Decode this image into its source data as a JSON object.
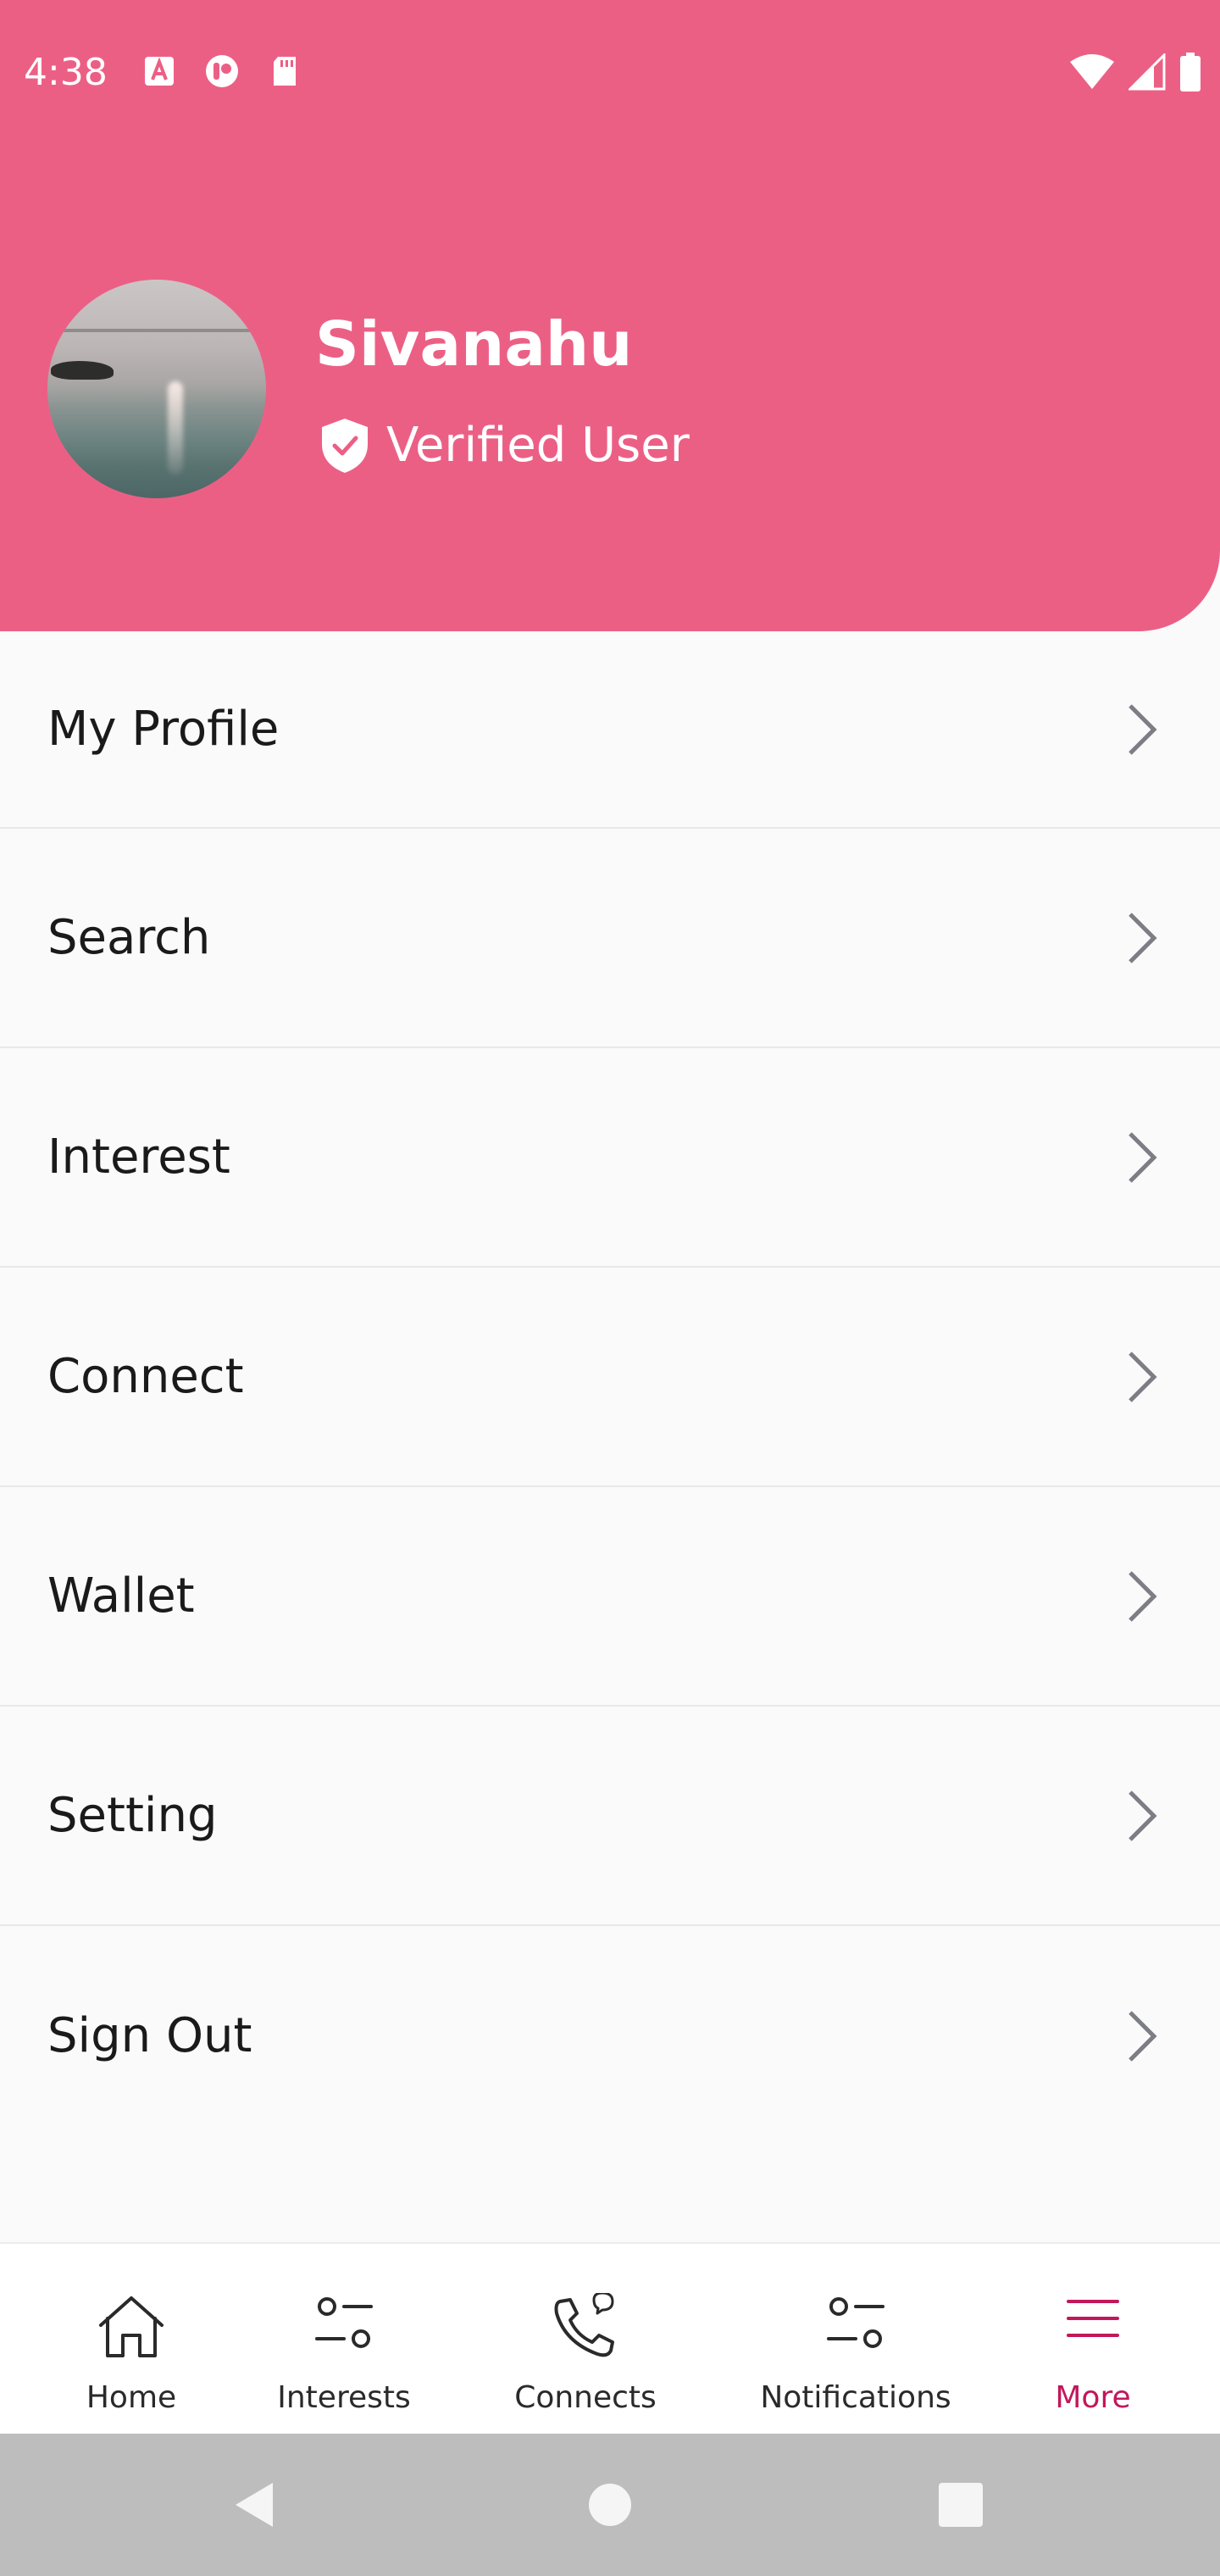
{
  "status_bar": {
    "time": "4:38",
    "left_icons": [
      "text-a-icon",
      "circle-app-icon",
      "sd-card-icon"
    ],
    "right_icons": [
      "wifi-icon",
      "cell-signal-icon",
      "battery-icon"
    ]
  },
  "profile": {
    "name": "Sivanahu",
    "badge_icon": "shield-check-icon",
    "badge_text": "Verified User",
    "header_color": "#ec5f85"
  },
  "menu": {
    "items": [
      {
        "label": "My Profile",
        "icon": "chevron-right-icon"
      },
      {
        "label": "Search",
        "icon": "chevron-right-icon"
      },
      {
        "label": "Interest",
        "icon": "chevron-right-icon"
      },
      {
        "label": "Connect",
        "icon": "chevron-right-icon"
      },
      {
        "label": "Wallet",
        "icon": "chevron-right-icon"
      },
      {
        "label": "Setting",
        "icon": "chevron-right-icon"
      },
      {
        "label": "Sign Out",
        "icon": "chevron-right-icon"
      }
    ]
  },
  "bottom_nav": {
    "items": [
      {
        "label": "Home",
        "icon": "home-icon",
        "active": false
      },
      {
        "label": "Interests",
        "icon": "toggles-icon",
        "active": false
      },
      {
        "label": "Connects",
        "icon": "phone-chat-icon",
        "active": false
      },
      {
        "label": "Notifications",
        "icon": "toggles-icon",
        "active": false
      },
      {
        "label": "More",
        "icon": "menu-icon",
        "active": true
      }
    ],
    "active_color": "#c2185b"
  },
  "system_nav": {
    "buttons": [
      "back-triangle-icon",
      "home-circle-icon",
      "recents-square-icon"
    ]
  }
}
